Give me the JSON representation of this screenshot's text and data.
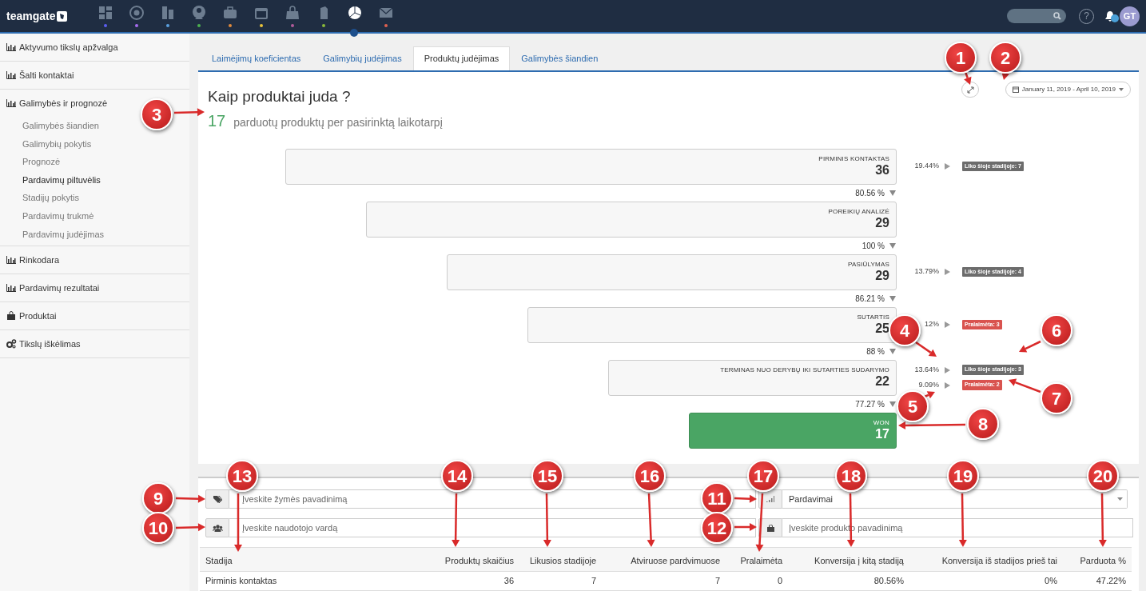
{
  "topbar": {
    "logo": "teamgate",
    "apps": [
      {
        "kind": "dashboard",
        "color": "#5b5ef0",
        "selected": false
      },
      {
        "kind": "target",
        "color": "#a66cf0",
        "selected": false
      },
      {
        "kind": "buildings",
        "color": "#5aa0e0",
        "selected": false
      },
      {
        "kind": "person",
        "color": "#4cb050",
        "selected": false
      },
      {
        "kind": "briefcase",
        "color": "#e08a3c",
        "selected": false
      },
      {
        "kind": "calendar",
        "color": "#e8c23a",
        "selected": false
      },
      {
        "kind": "bag",
        "color": "#b05a9a",
        "selected": false
      },
      {
        "kind": "clip",
        "color": "#8ab83a",
        "selected": false
      },
      {
        "kind": "pie",
        "color": "#1d4f8c",
        "selected": true
      },
      {
        "kind": "mail",
        "color": "#e06050",
        "selected": false
      }
    ],
    "help": "?",
    "avatar": "GT"
  },
  "sidebar": [
    {
      "label": "Aktyvumo tikslų apžvalga"
    },
    {
      "label": "Šalti kontaktai"
    },
    {
      "label": "Galimybės ir prognozė",
      "children": [
        {
          "label": "Galimybės šiandien",
          "selected": false
        },
        {
          "label": "Galimybių pokytis",
          "selected": false
        },
        {
          "label": "Prognozė",
          "selected": false
        },
        {
          "label": "Pardavimų piltuvėlis",
          "selected": true
        },
        {
          "label": "Stadijų pokytis",
          "selected": false
        },
        {
          "label": "Pardavimų trukmė",
          "selected": false
        },
        {
          "label": "Pardavimų judėjimas",
          "selected": false
        }
      ]
    },
    {
      "label": "Rinkodara"
    },
    {
      "label": "Pardavimų rezultatai"
    },
    {
      "label": "Produktai"
    },
    {
      "label": "Tikslų iškėlimas"
    }
  ],
  "tabs": [
    {
      "label": "Laimėjimų koeficientas",
      "selected": false
    },
    {
      "label": "Galimybių judėjimas",
      "selected": false
    },
    {
      "label": "Produktų judėjimas",
      "selected": true
    },
    {
      "label": "Galimybės šiandien",
      "selected": false
    }
  ],
  "report": {
    "title": "Kaip produktai juda ?",
    "count": "17",
    "caption": "parduotų produktų per pasirinktą laikotarpį",
    "date_range": "January 11, 2019 - April 10, 2019",
    "stages": [
      {
        "name": "PIRMINIS KONTAKTAS",
        "count": "36",
        "kind": "open",
        "conversion": "80.56 %",
        "side": [
          {
            "percent": "19.44%",
            "badge": "Liko šioje stadijoje: 7",
            "kind": "remaining"
          }
        ]
      },
      {
        "name": "POREIKIŲ ANALIZĖ",
        "count": "29",
        "kind": "open",
        "conversion": "100 %"
      },
      {
        "name": "PASIŪLYMAS",
        "count": "29",
        "kind": "open",
        "conversion": "86.21 %",
        "side": [
          {
            "percent": "13.79%",
            "badge": "Liko šioje stadijoje: 4",
            "kind": "remaining"
          }
        ]
      },
      {
        "name": "SUTARTIS",
        "count": "25",
        "kind": "open",
        "conversion": "88 %",
        "side": [
          {
            "percent": "12%",
            "badge": "Pralaimėta: 3",
            "kind": "lost"
          }
        ]
      },
      {
        "name": "TERMINAS NUO DERYBŲ IKI SUTARTIES SUDARYMO",
        "count": "22",
        "kind": "open",
        "conversion": "77.27 %",
        "side": [
          {
            "percent": "13.64%",
            "badge": "Liko šioje stadijoje: 3",
            "kind": "remaining"
          },
          {
            "percent": "9.09%",
            "badge": "Pralaimėta: 2",
            "kind": "lost"
          }
        ]
      },
      {
        "name": "WON",
        "count": "17",
        "kind": "won"
      }
    ]
  },
  "filters": {
    "tag_placeholder": "Įveskite žymės pavadinimą",
    "user_placeholder": "Įveskite naudotojo vardą",
    "pipeline": "Pardavimai",
    "product_placeholder": "Įveskite produkto pavadinimą"
  },
  "table": {
    "columns": [
      "Stadija",
      "Produktų skaičius",
      "Likusios stadijoje",
      "Atviruose pardvimuose",
      "Pralaimėta",
      "Konversija į kitą stadiją",
      "Konversija iš stadijos prieš tai",
      "Parduota %"
    ],
    "rows": [
      [
        "Pirminis kontaktas",
        "36",
        "7",
        "7",
        "0",
        "80.56%",
        "0%",
        "47.22%"
      ]
    ]
  },
  "callouts": [
    "1",
    "2",
    "3",
    "4",
    "5",
    "6",
    "7",
    "8",
    "9",
    "10",
    "11",
    "12",
    "13",
    "14",
    "15",
    "16",
    "17",
    "18",
    "19",
    "20"
  ]
}
